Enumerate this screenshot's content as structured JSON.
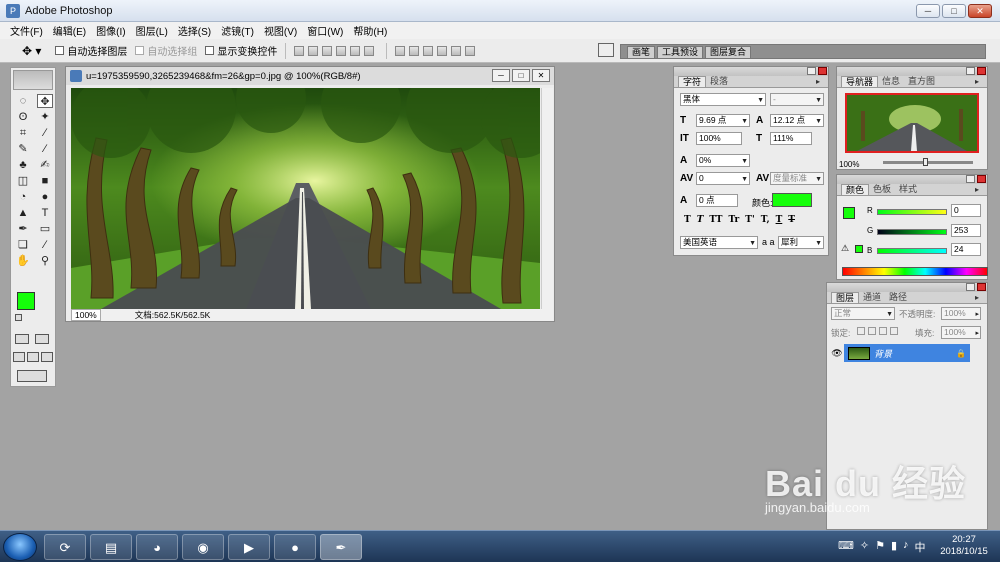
{
  "app": {
    "title": "Adobe Photoshop"
  },
  "window_buttons": {
    "minimize": "─",
    "maximize": "□",
    "close": "✕"
  },
  "menu": [
    "文件(F)",
    "编辑(E)",
    "图像(I)",
    "图层(L)",
    "选择(S)",
    "滤镜(T)",
    "视图(V)",
    "窗口(W)",
    "帮助(H)"
  ],
  "options": {
    "move_tool_glyph": "✥ ▾",
    "auto_select_layer": "自动选择图层",
    "auto_select_group": "自动选择组",
    "show_transform": "显示变换控件",
    "well_tabs": [
      "画笔",
      "工具预设",
      "图层复合"
    ]
  },
  "toolbox": {
    "tools": [
      "◌",
      "✥",
      "ʘ",
      "✦",
      "⌗",
      "∕",
      "✎",
      "∕",
      "♣",
      "✍",
      "◫",
      "■",
      "◔",
      "●",
      "▲",
      "T",
      "✒",
      "▭",
      "❏",
      "∕",
      "✋",
      "⚲"
    ]
  },
  "document": {
    "title": "u=1975359590,3265239468&fm=26&gp=0.jpg @ 100%(RGB/8#)",
    "zoom": "100%",
    "doc_size": "文档:562.5K/562.5K"
  },
  "character_panel": {
    "tabs": [
      "字符",
      "段落"
    ],
    "font_family": "黑体",
    "font_style": "-",
    "font_size": "9.69 点",
    "leading": "12.12 点",
    "vertical_scale": "100%",
    "horizontal_scale": "111%",
    "kerning_pct": "0%",
    "tracking": "0",
    "metrics": "度量标准",
    "baseline": "0 点",
    "color_label": "颜色:",
    "style_buttons": [
      "T",
      "T",
      "TT",
      "Tr",
      "T'",
      "T,",
      "T",
      "T"
    ],
    "language": "美国英语",
    "aa_label": "a a",
    "antialias": "犀利",
    "color": "#15ff0a"
  },
  "navigator_panel": {
    "tabs": [
      "导航器",
      "信息",
      "直方图"
    ],
    "zoom": "100%"
  },
  "color_panel": {
    "tabs": [
      "颜色",
      "色板",
      "样式"
    ],
    "r_label": "R",
    "g_label": "G",
    "b_label": "B",
    "r": "0",
    "g": "253",
    "b": "24",
    "fg": "#15ff0a",
    "warn": "⚠"
  },
  "layers_panel": {
    "tabs": [
      "图层",
      "通道",
      "路径"
    ],
    "blend_mode": "正常",
    "opacity_label": "不透明度:",
    "opacity": "100%",
    "lock_label": "锁定:",
    "fill_label": "填充:",
    "fill": "100%",
    "layer_name": "背景",
    "lock_icon": "🔒"
  },
  "taskbar": {
    "time": "20:27",
    "date": "2018/10/15"
  },
  "watermark": {
    "logo": "Bai du 经验",
    "url": "jingyan.baidu.com"
  }
}
